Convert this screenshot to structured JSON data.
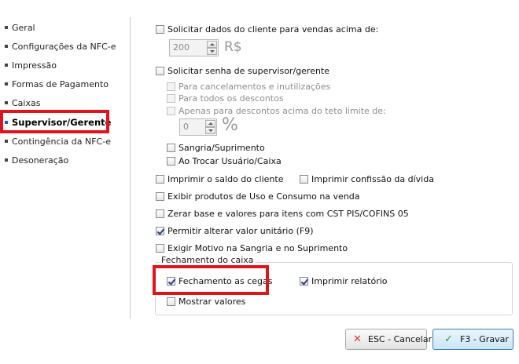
{
  "sidebar": {
    "items": [
      {
        "label": "Geral"
      },
      {
        "label": "Configurações da NFC-e"
      },
      {
        "label": "Impressão"
      },
      {
        "label": "Formas de Pagamento"
      },
      {
        "label": "Caixas"
      },
      {
        "label": "Supervisor/Gerente"
      },
      {
        "label": "Contingência da NFC-e"
      },
      {
        "label": "Desoneração"
      }
    ],
    "active": "Supervisor/Gerente"
  },
  "options": {
    "solicitar_dados_cliente": {
      "label": "Solicitar dados do cliente para vendas acima de:",
      "checked": false
    },
    "valor_minimo": {
      "value": "200",
      "unit": "R$"
    },
    "solicitar_senha": {
      "label": "Solicitar senha de supervisor/gerente",
      "checked": false
    },
    "sub_cancelamentos": {
      "label": "Para cancelamentos e inutilizações",
      "checked": false
    },
    "sub_descontos": {
      "label": "Para todos os descontos",
      "checked": false
    },
    "sub_teto": {
      "label": "Apenas para descontos acima do teto limite de:",
      "checked": false
    },
    "teto_limite": {
      "value": "0",
      "unit": "%"
    },
    "sangria_suprimento": {
      "label": "Sangria/Suprimento",
      "checked": false
    },
    "trocar_usuario": {
      "label": "Ao Trocar Usuário/Caixa",
      "checked": false
    },
    "imprimir_saldo": {
      "label": "Imprimir o saldo do cliente",
      "checked": false
    },
    "imprimir_confissao": {
      "label": "Imprimir confissão da dívida",
      "checked": false
    },
    "exibir_produtos": {
      "label": "Exibir produtos de Uso e Consumo na venda",
      "checked": false
    },
    "zerar_base": {
      "label": "Zerar base e valores para itens com CST PIS/COFINS 05",
      "checked": false
    },
    "permitir_alterar": {
      "label": "Permitir alterar valor unitário (F9)",
      "checked": true
    },
    "exigir_motivo": {
      "label": "Exigir Motivo na Sangria e no Suprimento",
      "checked": false
    }
  },
  "fechamento": {
    "title": "Fechamento do caixa",
    "cegas": {
      "label": "Fechamento as cegas",
      "checked": true
    },
    "imprimir_relatorio": {
      "label": "Imprimir relatório",
      "checked": true
    },
    "mostrar_valores": {
      "label": "Mostrar valores",
      "checked": false
    }
  },
  "buttons": {
    "cancel": {
      "label": "ESC - Cancelar",
      "icon": "✕"
    },
    "save": {
      "label": "F3 - Gravar",
      "icon": "✓"
    }
  },
  "colors": {
    "highlight": "#e0141f",
    "active_bullet": "#1a5fd0",
    "cancel_icon": "#d9342b",
    "save_icon": "#2e9a3a"
  }
}
